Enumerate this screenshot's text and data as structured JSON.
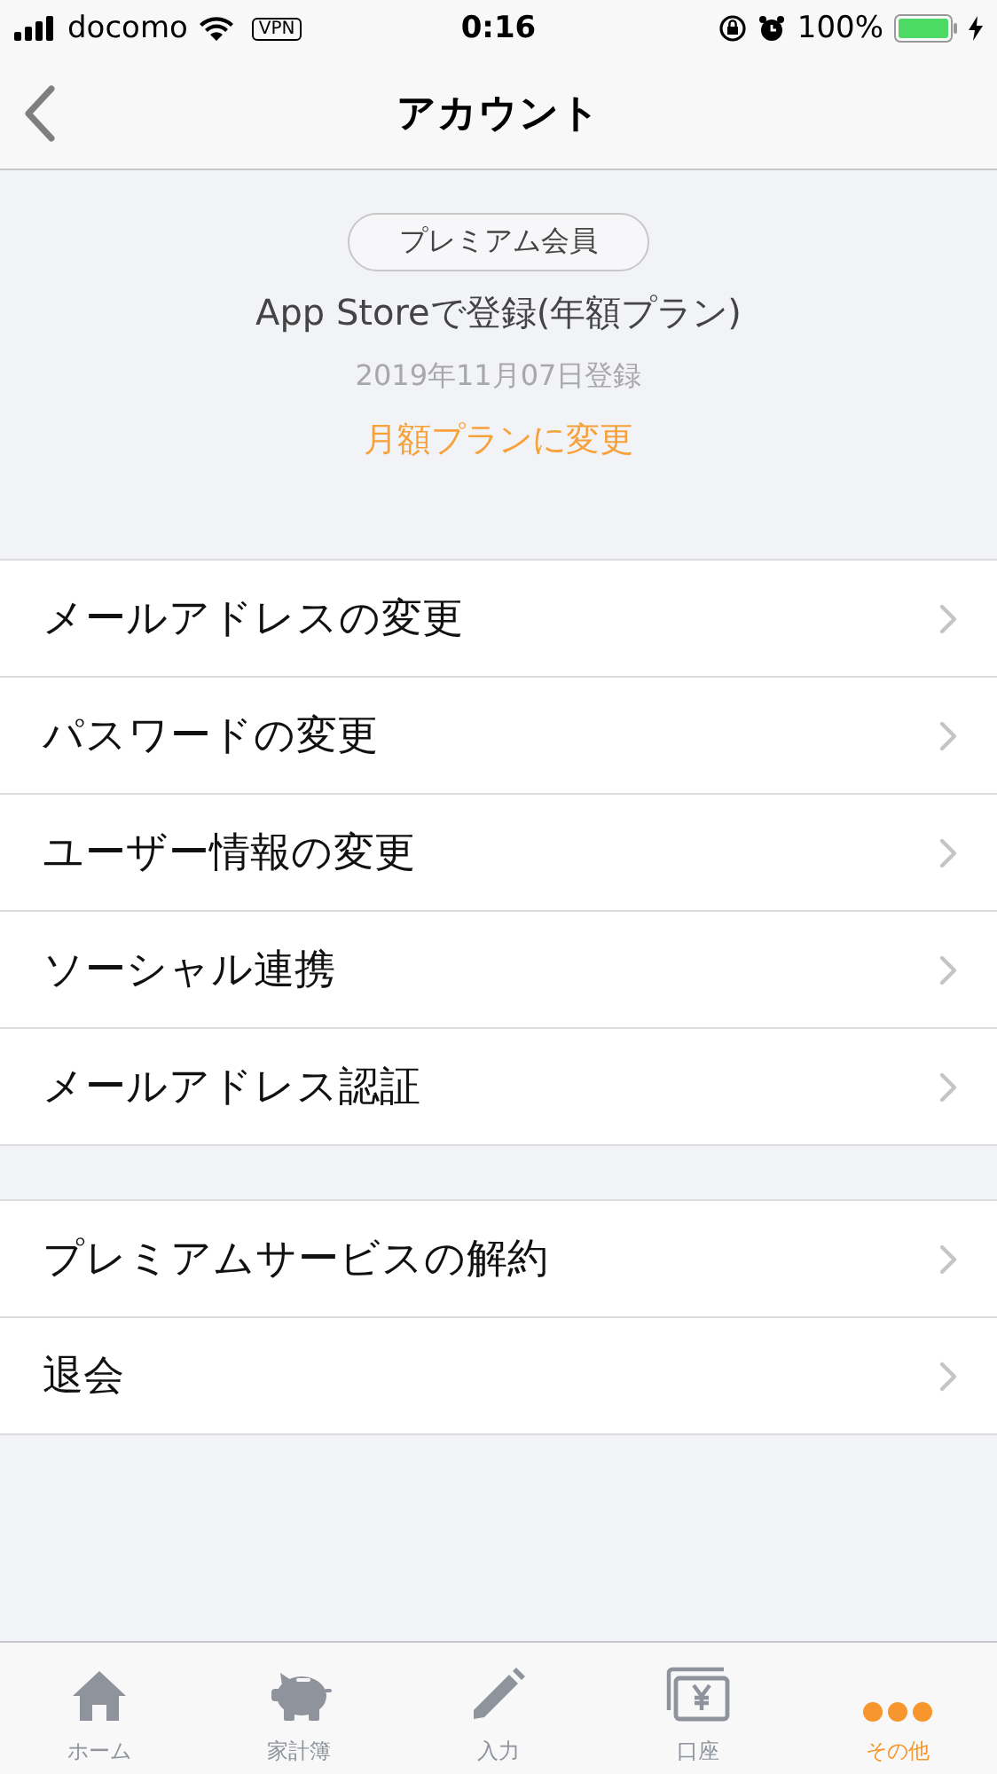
{
  "status_bar": {
    "carrier": "docomo",
    "vpn": "VPN",
    "time": "0:16",
    "battery": "100%"
  },
  "nav": {
    "title": "アカウント"
  },
  "membership": {
    "badge": "プレミアム会員",
    "plan": "App Storeで登録(年額プラン)",
    "date": "2019年11月07日登録",
    "link": "月額プランに変更"
  },
  "groups": [
    {
      "items": [
        "メールアドレスの変更",
        "パスワードの変更",
        "ユーザー情報の変更",
        "ソーシャル連携",
        "メールアドレス認証"
      ]
    },
    {
      "items": [
        "プレミアムサービスの解約",
        "退会"
      ]
    }
  ],
  "tabs": [
    {
      "label": "ホーム",
      "selected": false
    },
    {
      "label": "家計簿",
      "selected": false
    },
    {
      "label": "入力",
      "selected": false
    },
    {
      "label": "口座",
      "selected": false
    },
    {
      "label": "その他",
      "selected": true
    }
  ]
}
